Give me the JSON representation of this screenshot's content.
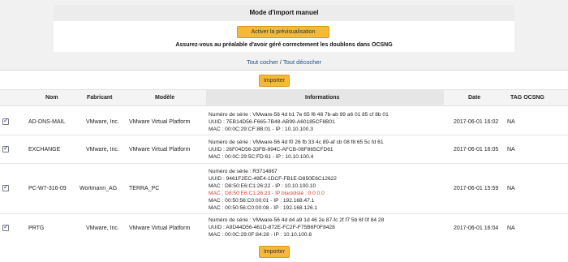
{
  "header": {
    "title": "Mode d'import manuel",
    "preview_button": "Activer la prévisualisation",
    "warning": "Assurez-vous au préalable d'avoir géré correctement les doublons dans OCSNG"
  },
  "links": {
    "check_all": "Tout cocher",
    "separator": "/",
    "uncheck_all": "Tout décocher"
  },
  "import_button": "Importer",
  "table": {
    "headers": {
      "name": "Nom",
      "manufacturer": "Fabricant",
      "model": "Modèle",
      "info": "Informations",
      "date": "Date",
      "tag": "TAG OCSNG"
    },
    "rows": [
      {
        "checked": true,
        "name": "AD-DNS-MAIL",
        "manufacturer": "VMware, Inc.",
        "model": "VMware Virtual Platform",
        "info": [
          {
            "text": "Numéro de série : VMware-56 4d b1 7e 65 f6 48 7b-ab 99 a6 01 85 cf 8b 01",
            "style": "normal"
          },
          {
            "text": "UUID : 7EB14D56-F665-7B48-AB99-A60185CF8B01",
            "style": "normal"
          },
          {
            "text": "MAC : 00:0C:29:CF:8B:01 - IP : 10.10.100.3",
            "style": "normal"
          }
        ],
        "date": "2017-06-01 16:02",
        "tag": "NA"
      },
      {
        "checked": true,
        "name": "EXCHANGE",
        "manufacturer": "VMware, Inc.",
        "model": "VMware Virtual Platform",
        "info": [
          {
            "text": "Numéro de série : VMware-56 4d f0 26 fb 33 4c 89-af cb 08 f8 65 5c fd 61",
            "style": "normal"
          },
          {
            "text": "UUID : 26F04D56-33FB-894C-AFCB-08F865CFD61",
            "style": "normal"
          },
          {
            "text": "MAC : 00:0C:29:5C:FD:61 - IP : 10.10.100.4",
            "style": "normal"
          }
        ],
        "date": "2017-06-01 16:05",
        "tag": "NA"
      },
      {
        "checked": true,
        "name": "PC-W7-316-09",
        "manufacturer": "Wortmann_AG",
        "model": "TERRA_PC",
        "info": [
          {
            "text": "Numéro de série : R3714867",
            "style": "normal"
          },
          {
            "text": "UUID : 9461F2EC-49E4-1DCF-FB1E-D850E6C12622",
            "style": "normal"
          },
          {
            "text": "MAC : D8:50:E6:C1:26:22 - IP : 10.10.100.10",
            "style": "normal"
          },
          {
            "text": "MAC : D8:50:E6:C1:26:23 - IP blacklisté : 0.0.0.0",
            "style": "red"
          },
          {
            "text": "MAC : 00:50:56:C0:00:01 - IP : 192.168.47.1",
            "style": "normal"
          },
          {
            "text": "MAC : 00:50:56:C0:00:08 - IP : 192.168.126.1",
            "style": "normal"
          }
        ],
        "date": "2017-06-01 15:59",
        "tag": "NA"
      },
      {
        "checked": true,
        "name": "PRTG",
        "manufacturer": "VMware, Inc.",
        "model": "VMware Virtual Platform",
        "info": [
          {
            "text": "Numéro de série : VMware-56 4d d4 a9 1d 46 2e 87-fc 2f f7 5b 6f 0f 84 28",
            "style": "normal"
          },
          {
            "text": "UUID : A9D44D56-461D-872E-FC2F-F75B6F0F8428",
            "style": "normal"
          },
          {
            "text": "MAC : 00:0C:29:0F:84:28 - IP : 10.10.100.8",
            "style": "normal"
          }
        ],
        "date": "2017-06-01 16:04",
        "tag": "NA"
      }
    ]
  },
  "colors": {
    "button": "#f5b93a",
    "link": "#1a4d8a",
    "blacklisted": "#e23a2f"
  }
}
